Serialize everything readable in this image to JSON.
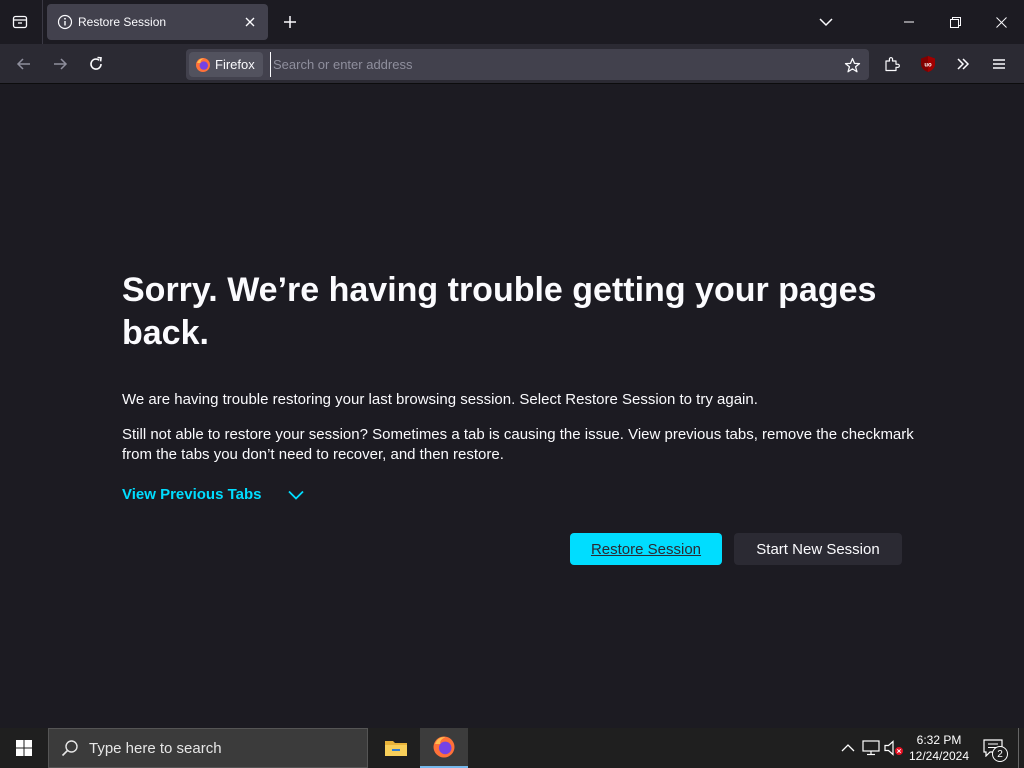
{
  "browser": {
    "tab": {
      "title": "Restore Session"
    },
    "urlbar": {
      "identity_label": "Firefox",
      "placeholder": "Search or enter address",
      "value": ""
    }
  },
  "page": {
    "heading": "Sorry. We’re having trouble getting your pages back.",
    "paragraph_1": "We are having trouble restoring your last browsing session. Select Restore Session to try again.",
    "paragraph_2": "Still not able to restore your session? Sometimes a tab is causing the issue. View previous tabs, remove the checkmark from the tabs you don’t need to recover, and then restore.",
    "view_previous_tabs": "View Previous Tabs",
    "restore_button": "Restore Session",
    "new_session_button": "Start New Session",
    "accent_color": "#00ddff"
  },
  "taskbar": {
    "search_placeholder": "Type here to search",
    "time": "6:32 PM",
    "date": "12/24/2024",
    "notification_count": "2"
  }
}
